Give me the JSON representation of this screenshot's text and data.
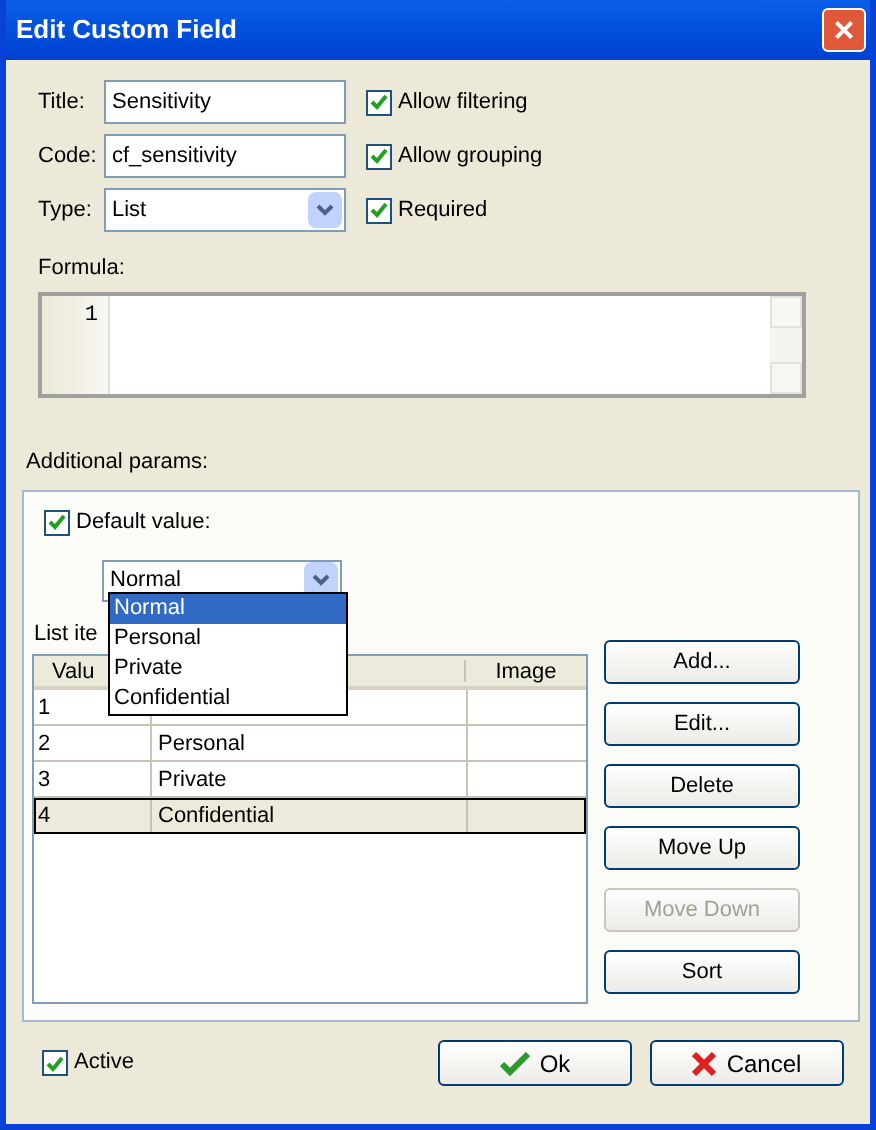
{
  "window": {
    "title": "Edit Custom Field",
    "close": "×"
  },
  "fields": [
    {
      "label": "Title:",
      "value": "Sensitivity",
      "kind": "text"
    },
    {
      "label": "Code:",
      "value": "cf_sensitivity",
      "kind": "text"
    },
    {
      "label": "Type:",
      "value": "List",
      "kind": "combo"
    }
  ],
  "options": [
    {
      "label": "Allow filtering",
      "checked": true
    },
    {
      "label": "Allow grouping",
      "checked": true
    },
    {
      "label": "Required",
      "checked": true
    }
  ],
  "formula": {
    "label": "Formula:",
    "line_numbers": [
      "1"
    ]
  },
  "additional_params": {
    "label": "Additional params:",
    "default_value": {
      "label": "Default value:",
      "checked": true,
      "value": "Normal",
      "dropdown": [
        {
          "label": "Normal",
          "selected": true
        },
        {
          "label": "Personal",
          "selected": false
        },
        {
          "label": "Private",
          "selected": false
        },
        {
          "label": "Confidential",
          "selected": false
        }
      ]
    },
    "list_items_label": "List ite",
    "table": {
      "columns": [
        {
          "label": "Valu"
        },
        {
          "label": "Image"
        }
      ],
      "rows": [
        {
          "value": "1",
          "selected": false
        },
        {
          "value": "2",
          "name": "Personal",
          "selected": false
        },
        {
          "value": "3",
          "name": "Private",
          "selected": false
        },
        {
          "value": "4",
          "name": "Confidential",
          "selected": true
        }
      ]
    },
    "buttons": [
      {
        "label": "Add...",
        "disabled": false
      },
      {
        "label": "Edit...",
        "disabled": false
      },
      {
        "label": "Delete",
        "disabled": false
      },
      {
        "label": "Move Up",
        "disabled": false
      },
      {
        "label": "Move Down",
        "disabled": true
      },
      {
        "label": "Sort",
        "disabled": false
      }
    ]
  },
  "active": {
    "label": "Active",
    "checked": true
  },
  "footer_buttons": [
    {
      "label": "Ok",
      "kind": "ok"
    },
    {
      "label": "Cancel",
      "kind": "cancel"
    }
  ]
}
